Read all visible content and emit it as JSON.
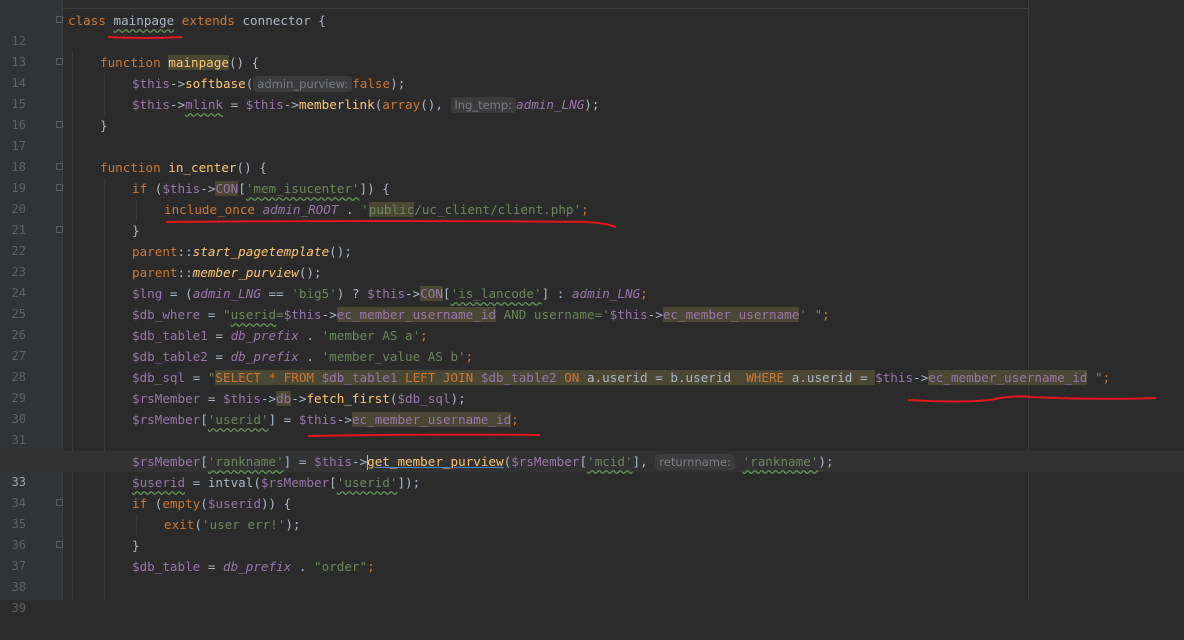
{
  "editor": {
    "current_line": "33",
    "lines": [
      {
        "n": "12",
        "t": {
          "a": "class",
          "b": "mainpage",
          "c": "extends",
          "d": "connector {"
        }
      },
      {
        "n": "13"
      },
      {
        "n": "14",
        "t": {
          "a": "function",
          "b": "mainpage",
          "c": "() {"
        }
      },
      {
        "n": "15",
        "t": {
          "a": "$this",
          "b": "->",
          "c": "softbase",
          "d": "(",
          "hint": "admin_purview:",
          "e": "false",
          "f": ");"
        }
      },
      {
        "n": "16",
        "t": {
          "a": "$this",
          "b": "->",
          "c": "mlink",
          "d": " = ",
          "e": "$this",
          "f": "->",
          "g": "memberlink",
          "h": "(",
          "i": "array",
          "j": "(),",
          "hint": "lng_temp:",
          "k": "admin_LNG",
          "l": ");"
        }
      },
      {
        "n": "17",
        "t": {
          "a": "}"
        }
      },
      {
        "n": "18"
      },
      {
        "n": "19",
        "t": {
          "a": "function",
          "b": "in_center",
          "c": "() {"
        }
      },
      {
        "n": "20",
        "t": {
          "a": "if",
          "b": " (",
          "c": "$this",
          "d": "->",
          "e": "CON",
          "f": "[",
          "g": "'mem_isucenter'",
          "h": "]) {"
        }
      },
      {
        "n": "21",
        "t": {
          "a": "include_once",
          "b": "admin_ROOT",
          "c": " . ",
          "d": "'",
          "e": "public",
          "f": "/uc_client/client.php'",
          "g": ";"
        }
      },
      {
        "n": "22",
        "t": {
          "a": "}"
        }
      },
      {
        "n": "23",
        "t": {
          "a": "parent",
          "b": "::",
          "c": "start_pagetemplate",
          "d": "();"
        }
      },
      {
        "n": "24",
        "t": {
          "a": "parent",
          "b": "::",
          "c": "member_purview",
          "d": "();"
        }
      },
      {
        "n": "25",
        "t": {
          "a": "$lng",
          "b": " = (",
          "c": "admin_LNG",
          "d": " == ",
          "e": "'big5'",
          "f": ") ? ",
          "g": "$this",
          "h": "->",
          "i": "CON",
          "j": "[",
          "k": "'is_lancode'",
          "l": "] : ",
          "m": "admin_LNG",
          "n": ";"
        }
      },
      {
        "n": "26",
        "t": {
          "a": "$db_where",
          "b": " = ",
          "c": "\"",
          "d": "userid",
          "e": "=",
          "f": "$this",
          "g": "->",
          "h": "ec_member_username_id",
          "i": " AND username='",
          "j": "$this",
          "k": "->",
          "l": "ec_member_username",
          "m": "' \"",
          "n": ";"
        }
      },
      {
        "n": "27",
        "t": {
          "a": "$db_table1",
          "b": " = ",
          "c": "db_prefix",
          "d": " . ",
          "e": "'member AS a'",
          "f": ";"
        }
      },
      {
        "n": "28",
        "t": {
          "a": "$db_table2",
          "b": " = ",
          "c": "db_prefix",
          "d": " . ",
          "e": "'member_value AS b'",
          "f": ";"
        }
      },
      {
        "n": "29",
        "t": {
          "a": "$db_sql",
          "b": " = ",
          "c": "\"",
          "d": "SELECT * FROM ",
          "e": "$db_table1",
          "f": " LEFT JOIN ",
          "g": "$db_table2",
          "h": " ON ",
          "i": "a.userid = b.userid  ",
          "j": "WHERE ",
          "k": "a.userid = ",
          "l": "$this",
          "m": "->",
          "n": "ec_member_username_id",
          "o": " \"",
          "p": ";"
        }
      },
      {
        "n": "30",
        "t": {
          "a": "$rsMember",
          "b": " = ",
          "c": "$this",
          "d": "->",
          "e": "db",
          "f": "->",
          "g": "fetch_first",
          "h": "(",
          "i": "$db_sql",
          "j": ");"
        }
      },
      {
        "n": "31",
        "t": {
          "a": "$rsMember",
          "b": "[",
          "c": "'userid'",
          "d": "] = ",
          "e": "$this",
          "f": "->",
          "g": "ec_member_username_id",
          "h": ";"
        }
      },
      {
        "n": "32"
      },
      {
        "n": "33",
        "t": {
          "a": "$rsMember",
          "b": "[",
          "c": "'rankname'",
          "d": "] = ",
          "e": "$this",
          "f": "->",
          "g": "get_member_purview",
          "h": "(",
          "i": "$rsMember",
          "j": "[",
          "k": "'mcid'",
          "l": "],",
          "hint": "returnname:",
          "m": "'rankname'",
          "n": ");"
        }
      },
      {
        "n": "34",
        "t": {
          "a": "$userid",
          "b": " = ",
          "c": "intval",
          "d": "(",
          "e": "$rsMember",
          "f": "[",
          "g": "'userid'",
          "h": "]);"
        }
      },
      {
        "n": "35",
        "t": {
          "a": "if",
          "b": " (",
          "c": "empty",
          "d": "(",
          "e": "$userid",
          "f": ")) {"
        }
      },
      {
        "n": "36",
        "t": {
          "a": "exit",
          "b": "(",
          "c": "'user err!'",
          "d": ");"
        }
      },
      {
        "n": "37",
        "t": {
          "a": "}"
        }
      },
      {
        "n": "38",
        "t": {
          "a": "$db_table",
          "b": " = ",
          "c": "db_prefix",
          "d": " . ",
          "e": "\"order\"",
          "f": ";"
        }
      },
      {
        "n": "39"
      }
    ]
  }
}
